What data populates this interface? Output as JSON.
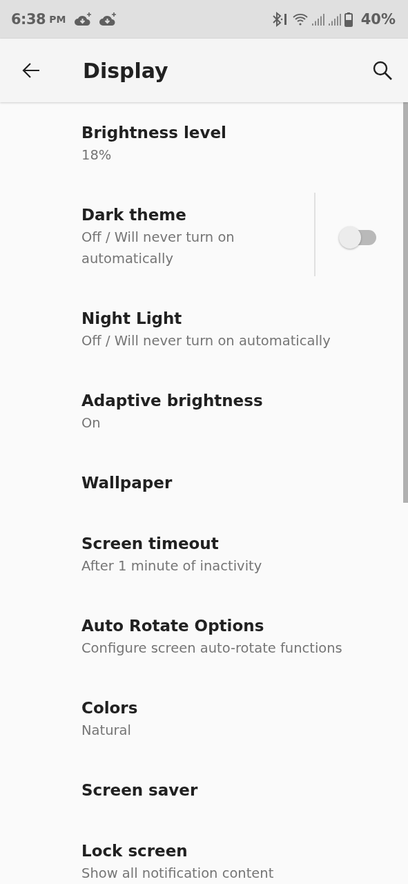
{
  "status_bar": {
    "time": "6:38",
    "ampm": "PM",
    "battery": "40%"
  },
  "app_bar": {
    "title": "Display"
  },
  "settings": [
    {
      "kind": "text",
      "title": "Brightness level",
      "summary": "18%"
    },
    {
      "kind": "toggle",
      "title": "Dark theme",
      "summary": "Off / Will never turn on automatically",
      "on": false
    },
    {
      "kind": "text",
      "title": "Night Light",
      "summary": "Off / Will never turn on automatically"
    },
    {
      "kind": "text",
      "title": "Adaptive brightness",
      "summary": "On"
    },
    {
      "kind": "text",
      "title": "Wallpaper"
    },
    {
      "kind": "text",
      "title": "Screen timeout",
      "summary": "After 1 minute of inactivity"
    },
    {
      "kind": "text",
      "title": "Auto Rotate Options",
      "summary": "Configure screen auto-rotate functions"
    },
    {
      "kind": "text",
      "title": "Colors",
      "summary": "Natural"
    },
    {
      "kind": "text",
      "title": "Screen saver"
    },
    {
      "kind": "text",
      "title": "Lock screen",
      "summary": "Show all notification content"
    }
  ]
}
